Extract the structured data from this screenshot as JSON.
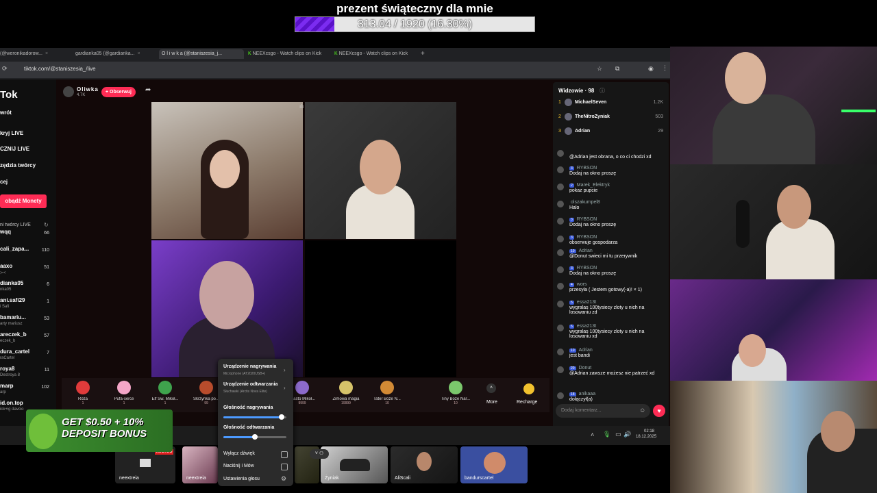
{
  "goal": {
    "title": "prezent świąteczny dla mnie",
    "progress_text": "313.04 / 1920 (16.30%)",
    "progress_fraction": 0.163
  },
  "tabs": [
    {
      "label": "(@weronikadorow..."
    },
    {
      "label": "gardianka05 (@gardianka..."
    },
    {
      "label": "O l i w k a (@staniszesia_j..."
    },
    {
      "label": "NEEXcsgo - Watch clips on Kick"
    },
    {
      "label": "NEEXcsgo - Watch clips on Kick"
    }
  ],
  "address": {
    "url": "tiktok.com/@staniszesia_/live"
  },
  "sidebar": {
    "logo": "Tok",
    "links": [
      "wrót",
      "kryj LIVE",
      "CZNIJ LIVE",
      "zędzia twórcy",
      "cej"
    ],
    "coins_button": "obądź Monety",
    "creators_header": "ni twórcy LIVE",
    "creators": [
      {
        "name": "wqq",
        "sub": "",
        "count": "66"
      },
      {
        "name": "cali_zapa...",
        "sub": "",
        "count": "110"
      },
      {
        "name": "aaxo",
        "sub": "≻<",
        "count": "51"
      },
      {
        "name": "dianka05",
        "sub": "nka05",
        "count": "6"
      },
      {
        "name": "ani.safi29",
        "sub": "i Safi",
        "count": "1"
      },
      {
        "name": "bamariu...",
        "sub": "arty mariusz",
        "count": "53"
      },
      {
        "name": "areczek_b",
        "sub": "eczek_b",
        "count": "57"
      },
      {
        "name": "dura_cartel",
        "sub": "raCartel",
        "count": "7"
      },
      {
        "name": "roya8",
        "sub": "Destroya 8",
        "count": "11"
      },
      {
        "name": "marp",
        "sub": "arp",
        "count": "102"
      },
      {
        "name": "id.on.top",
        "sub": "ick+ig davcio",
        "count": ""
      }
    ]
  },
  "stream": {
    "streamer_name": "Oliwka",
    "likes": "4.7K",
    "follow_label": "+ Obserwuj"
  },
  "gifts": [
    {
      "label": "Róża",
      "price": "1"
    },
    {
      "label": "Pufa-serce",
      "price": "1"
    },
    {
      "label": "Elf Św. Mikoł...",
      "price": "1"
    },
    {
      "label": "Skrzynka po...",
      "price": "99"
    },
    {
      "label": "...wię...",
      "price": ""
    },
    {
      "label": "Miasto Mikoł...",
      "price": "9999"
    },
    {
      "label": "Zimowa magia",
      "price": "19999"
    },
    {
      "label": "Tater Boże N...",
      "price": "10"
    },
    {
      "label": "Tiny Boże Nar...",
      "price": "10"
    }
  ],
  "gift_more": "More",
  "gift_recharge": "Recharge",
  "chat": {
    "viewers_label": "Widzowie · 98",
    "top_viewers": [
      {
        "rank": "1",
        "name": "MichaelSeven",
        "score": "1.2K"
      },
      {
        "rank": "2",
        "name": "TheNitroZyniak",
        "score": "503"
      },
      {
        "rank": "3",
        "name": "Adrian",
        "score": "29"
      }
    ],
    "messages": [
      {
        "badge": "",
        "user": "",
        "text": "@Adrian jest obrana, o co ci chodzi xd"
      },
      {
        "badge": "3",
        "user": "RYBSON",
        "text": "Dodaj na okno proszę"
      },
      {
        "badge": "2",
        "user": "Marek_Elektryk",
        "text": "pokaz pupcie"
      },
      {
        "badge": "",
        "user": "olszakumpel8",
        "text": "Halo"
      },
      {
        "badge": "3",
        "user": "RYBSON",
        "text": "Dodaj na okno proszę"
      },
      {
        "badge": "3",
        "user": "RYBSON",
        "text": "obserwuje gospodarza"
      },
      {
        "badge": "10",
        "user": "Adrian",
        "text": "@Donut swieci mi tu przerywnik"
      },
      {
        "badge": "3",
        "user": "RYBSON",
        "text": "Dodaj na okno proszę"
      },
      {
        "badge": "4",
        "user": "wors",
        "text": "przesyła ( Jestem gotowy(-a)! × 1)"
      },
      {
        "badge": "5",
        "user": "essa213t",
        "text": "wygralas 100tysiecy zloty u nich na losowaniu zd"
      },
      {
        "badge": "5",
        "user": "essa213t",
        "text": "wygralas 100tysiecy zloty u nich na losowaniu xd"
      },
      {
        "badge": "10",
        "user": "Adrian",
        "text": "jest bandi"
      },
      {
        "badge": "20",
        "user": "Donut",
        "text": "@Adrian zawsze możesz nie patrzeć xd"
      },
      {
        "badge": "18",
        "user": "anikaaa",
        "text": "dołączył(a)"
      }
    ],
    "comment_placeholder": "Dodaj komentarz..."
  },
  "audio": {
    "record_device_title": "Urządzenie nagrywania",
    "record_device_name": "Microphone (AT2020USB+)",
    "playback_device_title": "Urządzenie odtwarzania",
    "playback_device_name": "Słuchawki (Arctis Nova Elite)",
    "record_volume_label": "Głośność nagrywania",
    "record_volume": 0.92,
    "playback_volume_label": "Głośność odtwarzania",
    "playback_volume": 0.5,
    "mute_label": "Wyłącz dźwięk",
    "ptt_label": "Naciśnij i Mów",
    "settings_label": "Ustawienia głosu"
  },
  "taskbar": {
    "time": "02:18",
    "date": "18.12.2025"
  },
  "thumbs": [
    {
      "label": "neextreia"
    },
    {
      "label": "neextreia"
    },
    {
      "label": "Żyniak"
    },
    {
      "label": "AliScali"
    },
    {
      "label": "bandurscartel"
    }
  ],
  "live_badge": "NA ŻYWO",
  "promo": {
    "line1": "GET $0.50 + 10%",
    "line2": "DEPOSIT BONUS"
  },
  "colors": {
    "accent": "#fe2c55",
    "goal_fill": "#7b2cf0"
  }
}
